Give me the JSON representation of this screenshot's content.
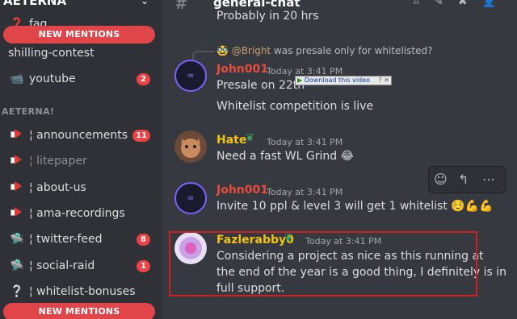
{
  "sidebar": {
    "server_name": "AETERNA",
    "mention_top": "NEW MENTIONS",
    "mention_bottom": "NEW MENTIONS",
    "category": "AETERNA!",
    "channels": [
      {
        "icon": "❓",
        "name": "faq",
        "badge": ""
      },
      {
        "icon": "",
        "name": "shilling-contest",
        "badge": ""
      },
      {
        "icon": "📹",
        "name": "youtube",
        "badge": "2"
      },
      {
        "icon": "megaphone",
        "name": "¦ announcements",
        "badge": "11"
      },
      {
        "icon": "megaphone",
        "name": "¦ litepaper",
        "badge": ""
      },
      {
        "icon": "megaphone",
        "name": "¦ about-us",
        "badge": ""
      },
      {
        "icon": "megaphone",
        "name": "¦ ama-recordings",
        "badge": ""
      },
      {
        "icon": "🛸",
        "name": "¦ twitter-feed",
        "badge": "8"
      },
      {
        "icon": "🛸",
        "name": "¦ social-raid",
        "badge": "1"
      },
      {
        "icon": "❔",
        "name": "¦ whitelist-bonuses",
        "badge": ""
      }
    ]
  },
  "header": {
    "hash": "#",
    "channel": "general-chat"
  },
  "previous_text": "Probably in 20 hrs",
  "reply": {
    "mention": "@Bright",
    "text": "was presale only for whitelisted?"
  },
  "messages": [
    {
      "author": "John001",
      "author_color": "#e74c3c",
      "time": "Today at 3:41 PM",
      "lines": [
        "Presale on 22th",
        "Whitelist competition is live"
      ]
    },
    {
      "author": "Hate",
      "author_color": "#f1c40f",
      "time": "Today at 3:41 PM",
      "lines": [
        "Need  a fast WL Grind 😂"
      ]
    },
    {
      "author": "John001",
      "author_color": "#e74c3c",
      "time": "Today at 3:41 PM",
      "lines": [
        "Invite 10 ppl & level 3 will get 1 whitelist ☺️💪💪"
      ]
    },
    {
      "author": "Fazlerabby0",
      "author_color": "#f1c40f",
      "time": "Today at 3:41 PM",
      "lines": [
        "Considering a project as nice as this running at",
        "the end of the year is a good thing, I definitely is in",
        "full support."
      ]
    }
  ],
  "download_bar": {
    "label": "Download this video",
    "close": "? ✕"
  }
}
